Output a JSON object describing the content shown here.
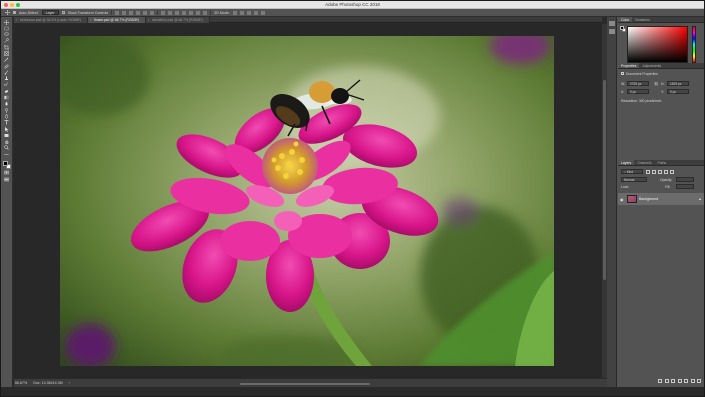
{
  "window": {
    "title": "Adobe Photoshop CC 2018"
  },
  "options_bar": {
    "auto_select_label": "Auto-Select:",
    "auto_select_checked": true,
    "auto_select_target": "Layer",
    "show_transform_label": "Show Transform Controls",
    "show_transform_checked": false,
    "mode_3d_label": "3D Mode:"
  },
  "tabs": [
    {
      "label": "birdhouse.psd @ 33.3% (Layer, RGB/8*)",
      "active": false
    },
    {
      "label": "flower.psd @ 66.7% (RGB/8*)",
      "active": true
    },
    {
      "label": "dandelion.psd @ 66.7% (RGB/8*)",
      "active": false
    }
  ],
  "status_bar": {
    "zoom": "66.67%",
    "doc_size": "Doc: 14.3M/14.3M"
  },
  "panels": {
    "color": {
      "tabs": [
        "Color",
        "Swatches"
      ],
      "active": 0
    },
    "properties": {
      "tabs": [
        "Properties",
        "Adjustments"
      ],
      "active": 0,
      "header": "Document Properties",
      "w_label": "W:",
      "w_value": "2729 px",
      "h_label": "H:",
      "h_value": "1819 px",
      "x_label": "X:",
      "x_value": "0 px",
      "y_label": "Y:",
      "y_value": "0 px",
      "resolution": "Resolution: 300 pixels/inch"
    },
    "layers": {
      "tabs": [
        "Layers",
        "Channels",
        "Paths"
      ],
      "active": 0,
      "kind_label": "Kind",
      "blend_mode": "Normal",
      "opacity_label": "Opacity:",
      "lock_label": "Lock:",
      "fill_label": "Fill:",
      "items": [
        {
          "name": "Background",
          "visible": true,
          "locked": true
        }
      ]
    }
  },
  "colors": {
    "accent": "#535353",
    "flower": "#d61d8c",
    "background_green": "#6f8a45"
  }
}
